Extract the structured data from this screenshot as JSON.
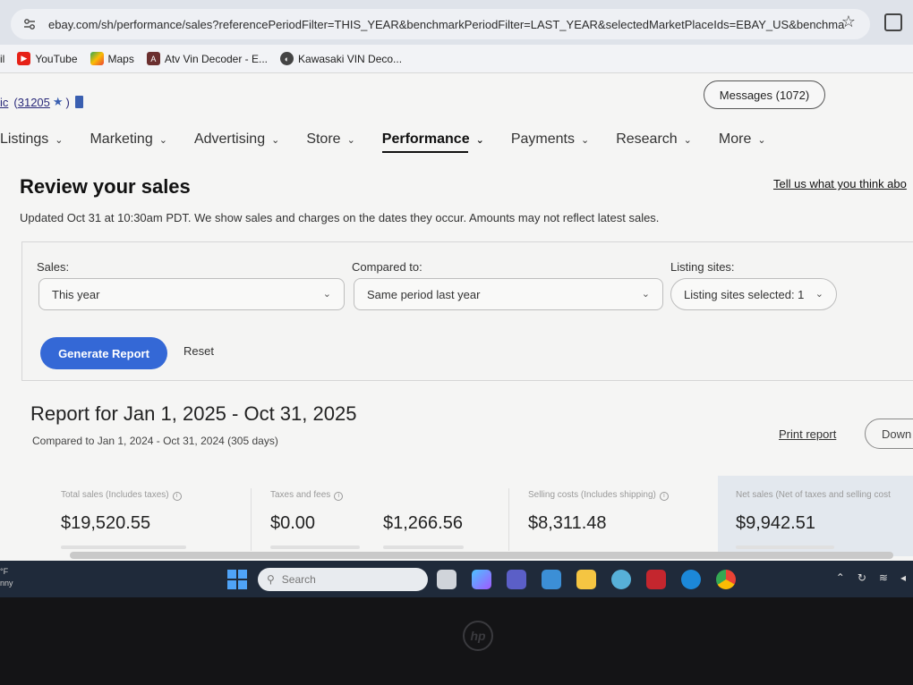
{
  "browser": {
    "url": "ebay.com/sh/performance/sales?referencePeriodFilter=THIS_YEAR&benchmarkPeriodFilter=LAST_YEAR&selectedMarketPlaceIds=EBAY_US&benchmar...",
    "bookmarks": [
      {
        "label": "il",
        "icon": "mail-icon"
      },
      {
        "label": "YouTube",
        "icon": "youtube-icon"
      },
      {
        "label": "Maps",
        "icon": "maps-icon"
      },
      {
        "label": "Atv Vin Decoder - E...",
        "icon": "atv-icon"
      },
      {
        "label": "Kawasaki VIN Deco...",
        "icon": "kawasaki-icon"
      }
    ]
  },
  "header": {
    "user_prefix": "ic",
    "feedback_score": "31205",
    "messages_label": "Messages (1072)"
  },
  "nav": {
    "items": [
      {
        "label": "Listings"
      },
      {
        "label": "Marketing"
      },
      {
        "label": "Advertising"
      },
      {
        "label": "Store"
      },
      {
        "label": "Performance"
      },
      {
        "label": "Payments"
      },
      {
        "label": "Research"
      },
      {
        "label": "More"
      }
    ],
    "active": "Performance"
  },
  "main": {
    "title": "Review your sales",
    "feedback_link": "Tell us what you think abo",
    "updated_text": "Updated Oct 31 at 10:30am PDT. We show sales and charges on the dates they occur. Amounts may not reflect latest sales."
  },
  "filters": {
    "sales_label": "Sales:",
    "sales_value": "This year",
    "compared_label": "Compared to:",
    "compared_value": "Same period last year",
    "sites_label": "Listing sites:",
    "sites_value": "Listing sites selected: 1",
    "generate_label": "Generate Report",
    "reset_label": "Reset"
  },
  "report": {
    "title": "Report for Jan 1, 2025 - Oct 31, 2025",
    "compared": "Compared to Jan 1, 2024 - Oct 31, 2024 (305 days)",
    "print_label": "Print report",
    "download_label": "Down"
  },
  "metrics": [
    {
      "label": "Total sales (Includes taxes)",
      "value": "$19,520.55"
    },
    {
      "label": "Taxes and fees",
      "value": "$0.00"
    },
    {
      "label": "",
      "value": "$1,266.56"
    },
    {
      "label": "Selling costs (Includes shipping)",
      "value": "$8,311.48"
    },
    {
      "label": "Net sales (Net of taxes and selling cost",
      "value": "$9,942.51"
    }
  ],
  "taskbar": {
    "weather_line1": "°F",
    "weather_line2": "nny",
    "search_placeholder": "Search"
  },
  "colors": {
    "primary_button": "#3468d6",
    "taskbar": "#1f2a3a"
  }
}
